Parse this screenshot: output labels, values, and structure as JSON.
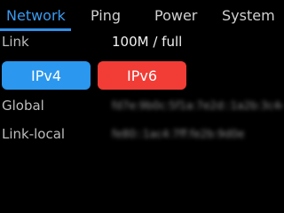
{
  "tabs": [
    {
      "label": "Network",
      "active": true
    },
    {
      "label": "Ping",
      "active": false
    },
    {
      "label": "Power",
      "active": false
    },
    {
      "label": "System",
      "active": false
    }
  ],
  "link": {
    "label": "Link",
    "value": "100M / full"
  },
  "buttons": {
    "ipv4": "IPv4",
    "ipv6": "IPv6"
  },
  "global": {
    "label": "Global",
    "value": "fd7e:9b0c:5f1a:7e2d::1a2b:3c4d"
  },
  "link_local": {
    "label": "Link-local",
    "value": "fe80::1ac4:7ff:fe2b:9d0e"
  },
  "colors": {
    "accent": "#2f8fe8",
    "ipv4": "#2b97ee",
    "ipv6": "#f23c36",
    "background": "#000000"
  }
}
